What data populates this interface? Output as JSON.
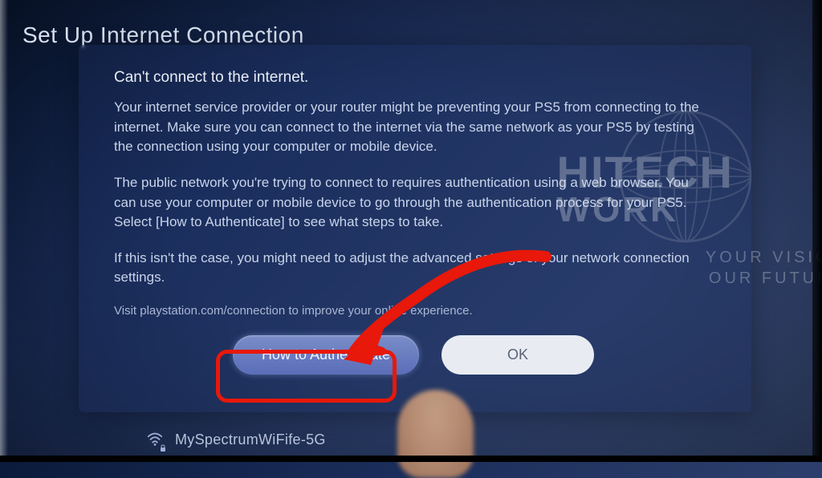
{
  "page_title": "Set Up Internet Connection",
  "modal": {
    "heading": "Can't connect to the internet.",
    "para1": "Your internet service provider or your router might be preventing your PS5 from connecting to the internet. Make sure you can connect to the internet via the same network as your PS5 by testing the connection using your computer or mobile device.",
    "para2": "The public network you're trying to connect to requires authentication using a web browser. You can use your computer or mobile device to go through the authentication process for your PS5. Select [How to Authenticate] to see what steps to take.",
    "para3": "If this isn't the case, you might need to adjust the advanced settings of your network connection settings.",
    "footnote": "Visit playstation.com/connection to improve your online experience."
  },
  "buttons": {
    "authenticate": "How to Authenticate",
    "ok": "OK"
  },
  "network": {
    "name": "MySpectrumWiFife-5G",
    "secured": true
  },
  "watermark": {
    "line1": "HITECH",
    "line2": "WORK",
    "tag1": "YOUR VISION",
    "tag2": "OUR FUTURE"
  },
  "annotation": {
    "arrow_color": "#e8180a",
    "highlight_target": "how-to-authenticate-button"
  }
}
